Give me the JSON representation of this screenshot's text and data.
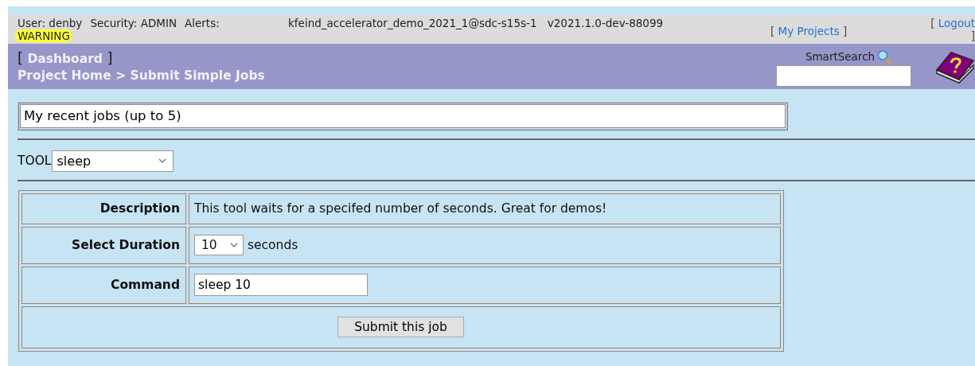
{
  "header": {
    "user": "User: denby",
    "security": "Security: ADMIN",
    "alerts_label": "Alerts:",
    "alert": "WARNING",
    "project": "kfeind_accelerator_demo_2021_1@sdc-s15s-1 v2021.1.0-dev-88099",
    "my_projects": {
      "open": "[",
      "label": "My Projects",
      "close": "]"
    },
    "logout": {
      "open": "[",
      "label": "Logout",
      "close": "]"
    }
  },
  "nav": {
    "dashboard": {
      "open": "[",
      "label": "Dashboard",
      "close": "]"
    },
    "breadcrumb": "Project Home > Submit Simple Jobs",
    "search_label": "SmartSearch"
  },
  "recent_jobs": "My recent jobs (up to 5)",
  "tool": {
    "label": "TOOL",
    "value": "sleep"
  },
  "form": {
    "rows": [
      {
        "kind": "text",
        "label": "Description",
        "value": "This tool waits for a specifed number of seconds. Great for demos!"
      },
      {
        "kind": "select",
        "label": "Select Duration",
        "value": "10",
        "unit": "seconds"
      },
      {
        "kind": "input",
        "label": "Command",
        "value": "sleep 10"
      }
    ],
    "submit": "Submit this job"
  }
}
